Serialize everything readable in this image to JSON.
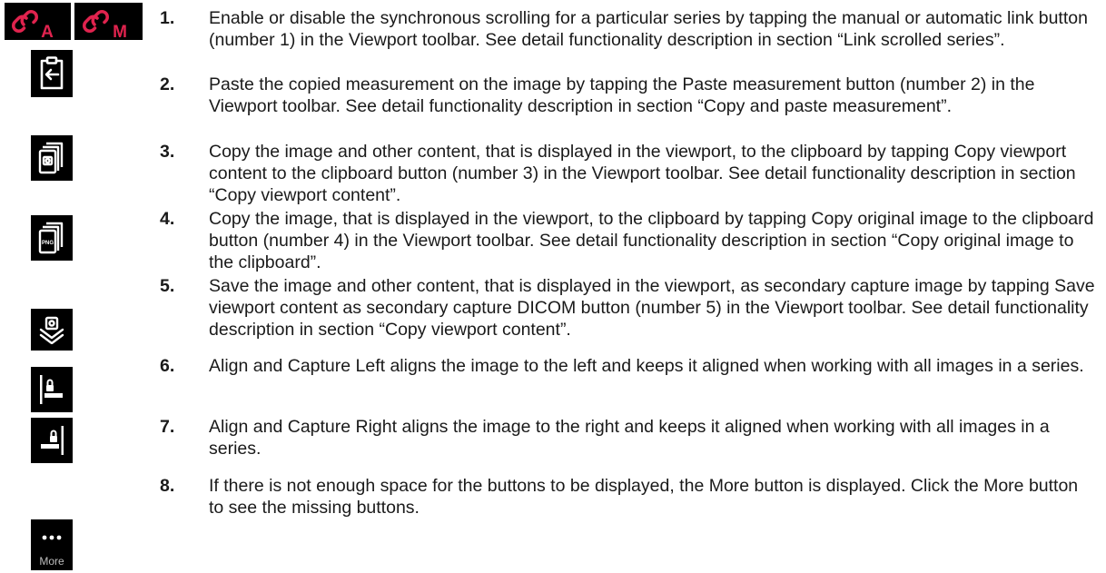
{
  "colors": {
    "link_accent": "#e0234e",
    "icon_tile": "#000000",
    "icon_stroke": "#ffffff"
  },
  "icons": {
    "link_auto": {
      "name": "link-auto-icon",
      "letter": "A"
    },
    "link_manual": {
      "name": "link-manual-icon",
      "letter": "M"
    },
    "paste": {
      "name": "paste-measurement-icon"
    },
    "copy_viewport": {
      "name": "copy-viewport-icon"
    },
    "copy_png": {
      "name": "copy-original-image-icon",
      "badge": "PNG"
    },
    "save_capture": {
      "name": "save-secondary-capture-icon"
    },
    "align_left": {
      "name": "align-capture-left-icon"
    },
    "align_right": {
      "name": "align-capture-right-icon"
    },
    "more": {
      "name": "more-icon",
      "label": "More"
    }
  },
  "items": [
    {
      "num": "1.",
      "text": "Enable or disable the synchronous scrolling for a particular series by tapping the manual or automatic link button (number 1) in the Viewport toolbar. See detail functionality description in section “Link scrolled series”."
    },
    {
      "num": "2.",
      "text": "Paste the copied measurement on the image by tapping the Paste measurement button (number 2) in the Viewport toolbar. See detail functionality description in section “Copy and paste measurement”."
    },
    {
      "num": "3.",
      "text": "Copy the image and other content, that is displayed in the viewport, to the clipboard by tapping Copy viewport content to the clipboard button (number 3) in the Viewport toolbar. See detail functionality description in section “Copy viewport content”."
    },
    {
      "num": "4.",
      "text": "Copy the image, that is displayed in the viewport, to the clipboard by tapping Copy original image to the clipboard button (number 4) in the Viewport toolbar. See detail functionality description in section “Copy original image to the clipboard”."
    },
    {
      "num": "5.",
      "text": "Save the image and other content, that is displayed in the viewport, as secondary capture image by tapping Save viewport content as secondary capture DICOM button (number 5) in the Viewport toolbar. See detail functionality description in section “Copy viewport content”."
    },
    {
      "num": "6.",
      "text": "Align and Capture Left aligns the image to the left and keeps it aligned when working with all images in a series."
    },
    {
      "num": "7.",
      "text": "Align and Capture Right aligns the image to the right and keeps it aligned when working with all images in a series."
    },
    {
      "num": "8.",
      "text": "If there is not enough space for the buttons to be displayed, the More button is displayed. Click the More button to see the missing buttons."
    }
  ]
}
